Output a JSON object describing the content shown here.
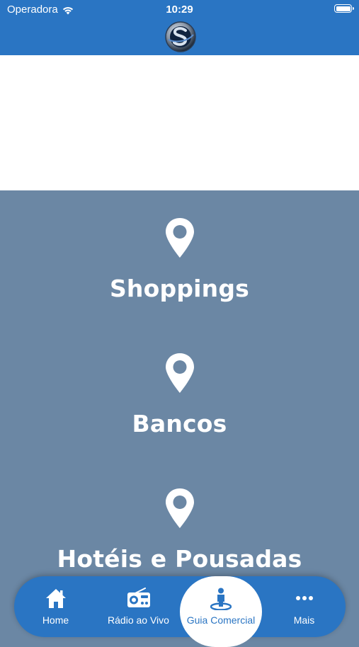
{
  "status_bar": {
    "carrier": "Operadora",
    "time": "10:29"
  },
  "header": {
    "logo_icon": "app-logo-s-icon"
  },
  "categories": [
    {
      "label": "Shoppings",
      "icon": "map-pin-icon"
    },
    {
      "label": "Bancos",
      "icon": "map-pin-icon"
    },
    {
      "label": "Hotéis e Pousadas",
      "icon": "map-pin-icon"
    }
  ],
  "tabbar": {
    "tabs": [
      {
        "label": "Home",
        "icon": "home-icon"
      },
      {
        "label": "Rádio ao Vivo",
        "icon": "radio-icon"
      },
      {
        "label": "Guia Comercial",
        "icon": "person-map-icon",
        "active": true
      },
      {
        "label": "Mais",
        "icon": "more-icon"
      }
    ]
  },
  "colors": {
    "primary": "#2a75c3",
    "content_bg": "#6b87a4",
    "white": "#ffffff"
  }
}
